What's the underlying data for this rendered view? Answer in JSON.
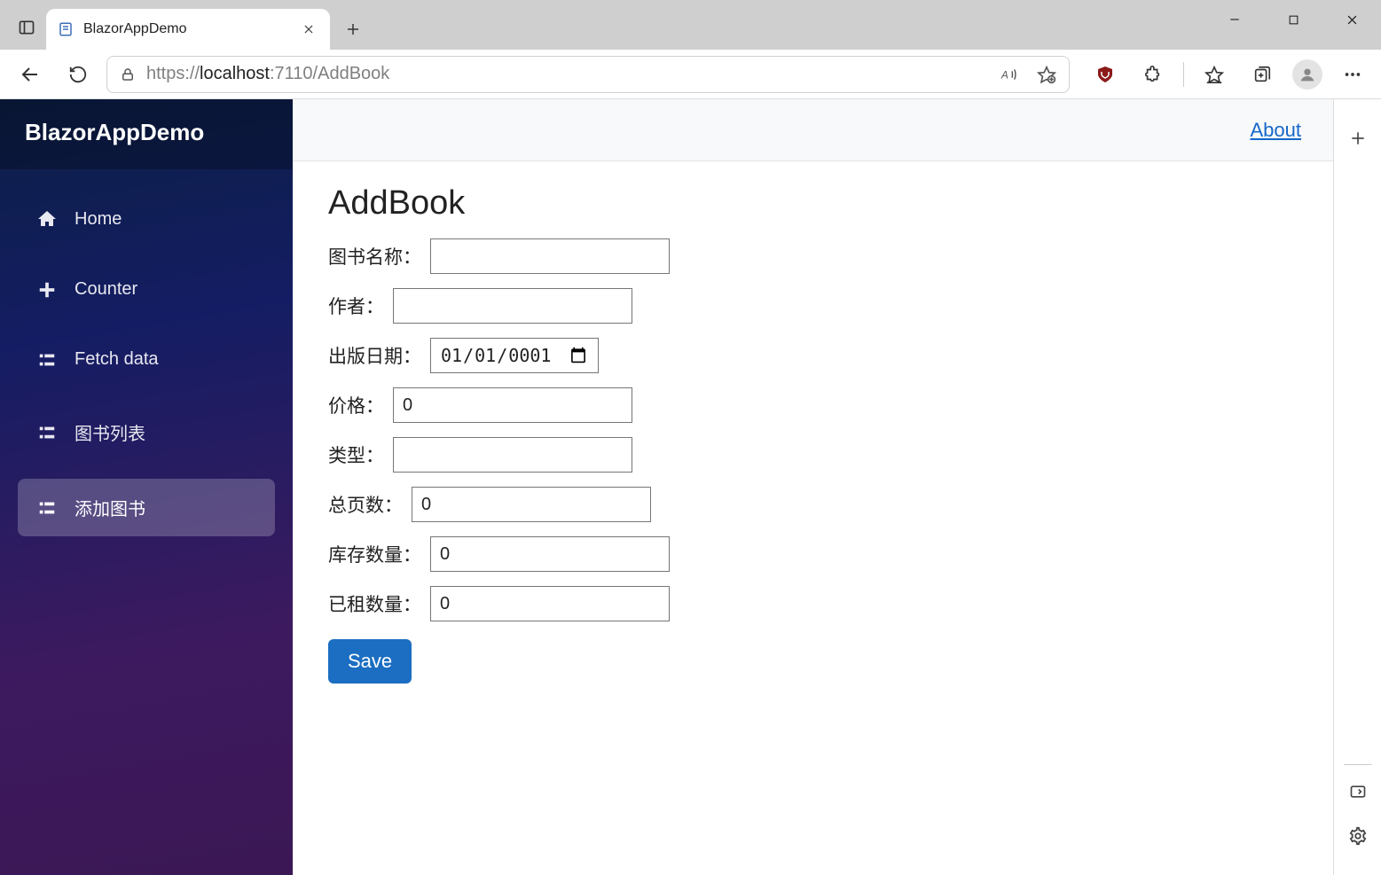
{
  "browser": {
    "tab_title": "BlazorAppDemo",
    "url_prefix": "https://",
    "url_host": "localhost",
    "url_port": ":7110",
    "url_path": "/AddBook"
  },
  "sidebar": {
    "brand": "BlazorAppDemo",
    "items": [
      {
        "label": "Home",
        "icon": "home",
        "active": false
      },
      {
        "label": "Counter",
        "icon": "plus",
        "active": false
      },
      {
        "label": "Fetch data",
        "icon": "list",
        "active": false
      },
      {
        "label": "图书列表",
        "icon": "list",
        "active": false
      },
      {
        "label": "添加图书",
        "icon": "list",
        "active": true
      }
    ]
  },
  "toprow": {
    "about": "About"
  },
  "page": {
    "title": "AddBook",
    "labels": {
      "name": "图书名称：",
      "author": "作者：",
      "release": "出版日期：",
      "price": "价格：",
      "type": "类型：",
      "pages": "总页数：",
      "stock": "库存数量：",
      "rented": "已租数量："
    },
    "values": {
      "name": "",
      "author": "",
      "release": "0001/01/01",
      "price": "0",
      "type": "",
      "pages": "0",
      "stock": "0",
      "rented": "0"
    },
    "save_label": "Save"
  }
}
